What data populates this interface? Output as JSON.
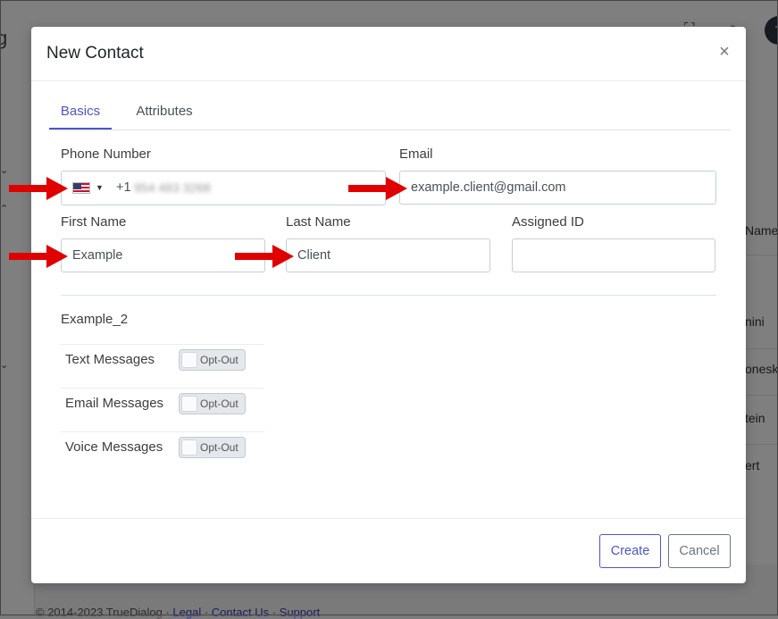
{
  "background": {
    "row_fragments": [
      "Name",
      "nini",
      "oneske",
      "tein",
      "ert"
    ],
    "footer": {
      "copyright": "© 2014-2023 TrueDialog",
      "links": [
        "Legal",
        "Contact Us",
        "Support"
      ]
    },
    "avatar_initial": "T"
  },
  "modal": {
    "title": "New Contact",
    "close_glyph": "×",
    "tabs": [
      {
        "label": "Basics",
        "active": true
      },
      {
        "label": "Attributes",
        "active": false
      }
    ],
    "fields": {
      "phone": {
        "label": "Phone Number",
        "country": "United States flag",
        "country_code": "+1",
        "number_blurred": "954 483 3268"
      },
      "email": {
        "label": "Email",
        "value": "example.client@gmail.com"
      },
      "first_name": {
        "label": "First Name",
        "value": "Example"
      },
      "last_name": {
        "label": "Last Name",
        "value": "Client"
      },
      "assigned_id": {
        "label": "Assigned ID",
        "value": ""
      }
    },
    "section_title": "Example_2",
    "preferences": [
      {
        "label": "Text Messages",
        "toggle": "Opt-Out"
      },
      {
        "label": "Email Messages",
        "toggle": "Opt-Out"
      },
      {
        "label": "Voice Messages",
        "toggle": "Opt-Out"
      }
    ],
    "buttons": {
      "create": "Create",
      "cancel": "Cancel"
    }
  },
  "colors": {
    "accent": "#4b56c6",
    "arrow": "#e00000",
    "overlay": "rgba(0,0,0,0.5)"
  }
}
